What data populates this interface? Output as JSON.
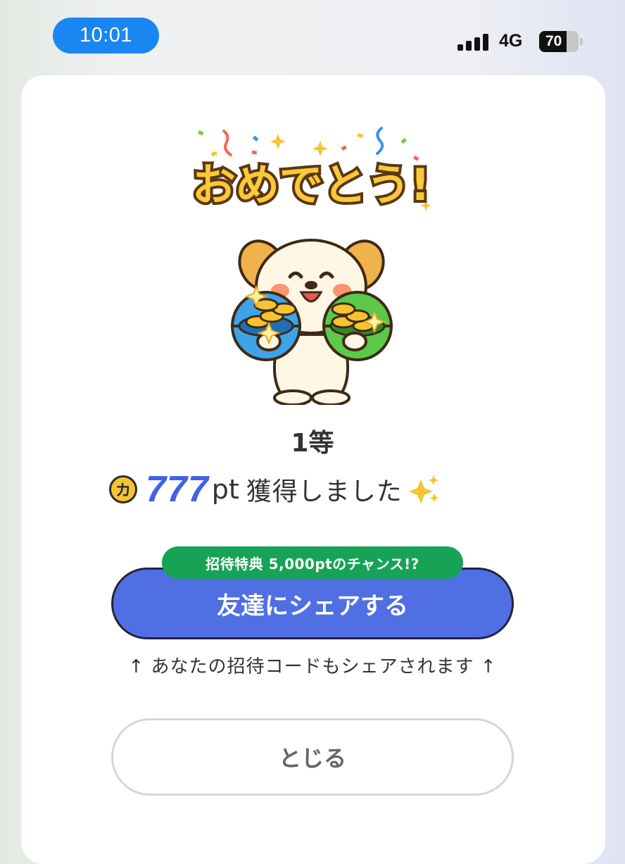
{
  "status_bar": {
    "time": "10:01",
    "network": "4G",
    "battery": "70",
    "battery_level_percent": 70,
    "time_pill_color": "#1a86f2"
  },
  "dialog": {
    "congrats_title": "おめでとう!",
    "rank": "1等",
    "points_currency_icon": "カ",
    "points_value": "777",
    "points_unit": "pt",
    "prize_text": "獲得しました",
    "sparkles_icon": "sparkles-icon",
    "promo_badge": "招待特典 5,000ptのチャンス!?",
    "share_button": "友達にシェアする",
    "share_note": "↑ あなたの招待コードもシェアされます ↑",
    "close_button": "とじる"
  },
  "colors": {
    "accent_blue": "#4f6fe3",
    "points_blue": "#3f62e8",
    "badge_green": "#17a356",
    "coin_gold": "#f5c430"
  }
}
